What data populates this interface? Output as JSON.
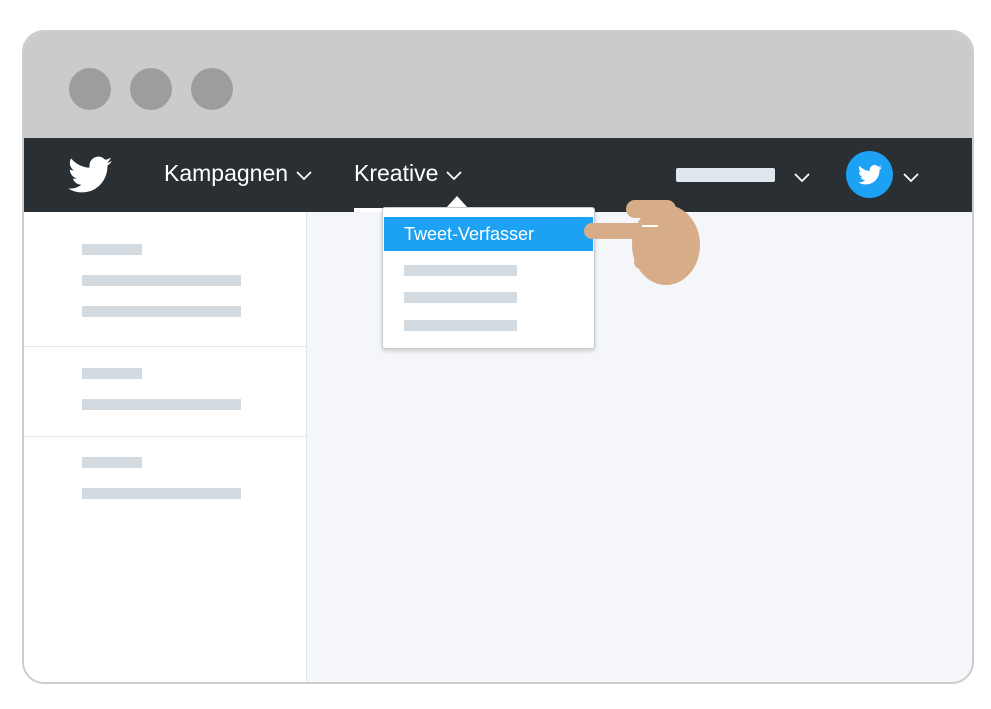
{
  "colors": {
    "titlebar": "#cbcbcb",
    "window_dot": "#9d9d9d",
    "navbar": "#292f33",
    "accent": "#1da1f2",
    "placeholder_bar": "#d3dae0",
    "content_bg": "#f4f6f9",
    "hand": "#d7ad89"
  },
  "navbar": {
    "logo_icon": "twitter-bird-icon",
    "items": [
      {
        "label": "Kampagnen",
        "icon": "chevron-down-icon"
      },
      {
        "label": "Kreative",
        "icon": "chevron-down-icon",
        "active": true
      }
    ],
    "account_icon": "twitter-bird-icon"
  },
  "dropdown": {
    "active_item": "Tweet-Verfasser"
  },
  "pointer_icon": "pointing-hand-icon"
}
